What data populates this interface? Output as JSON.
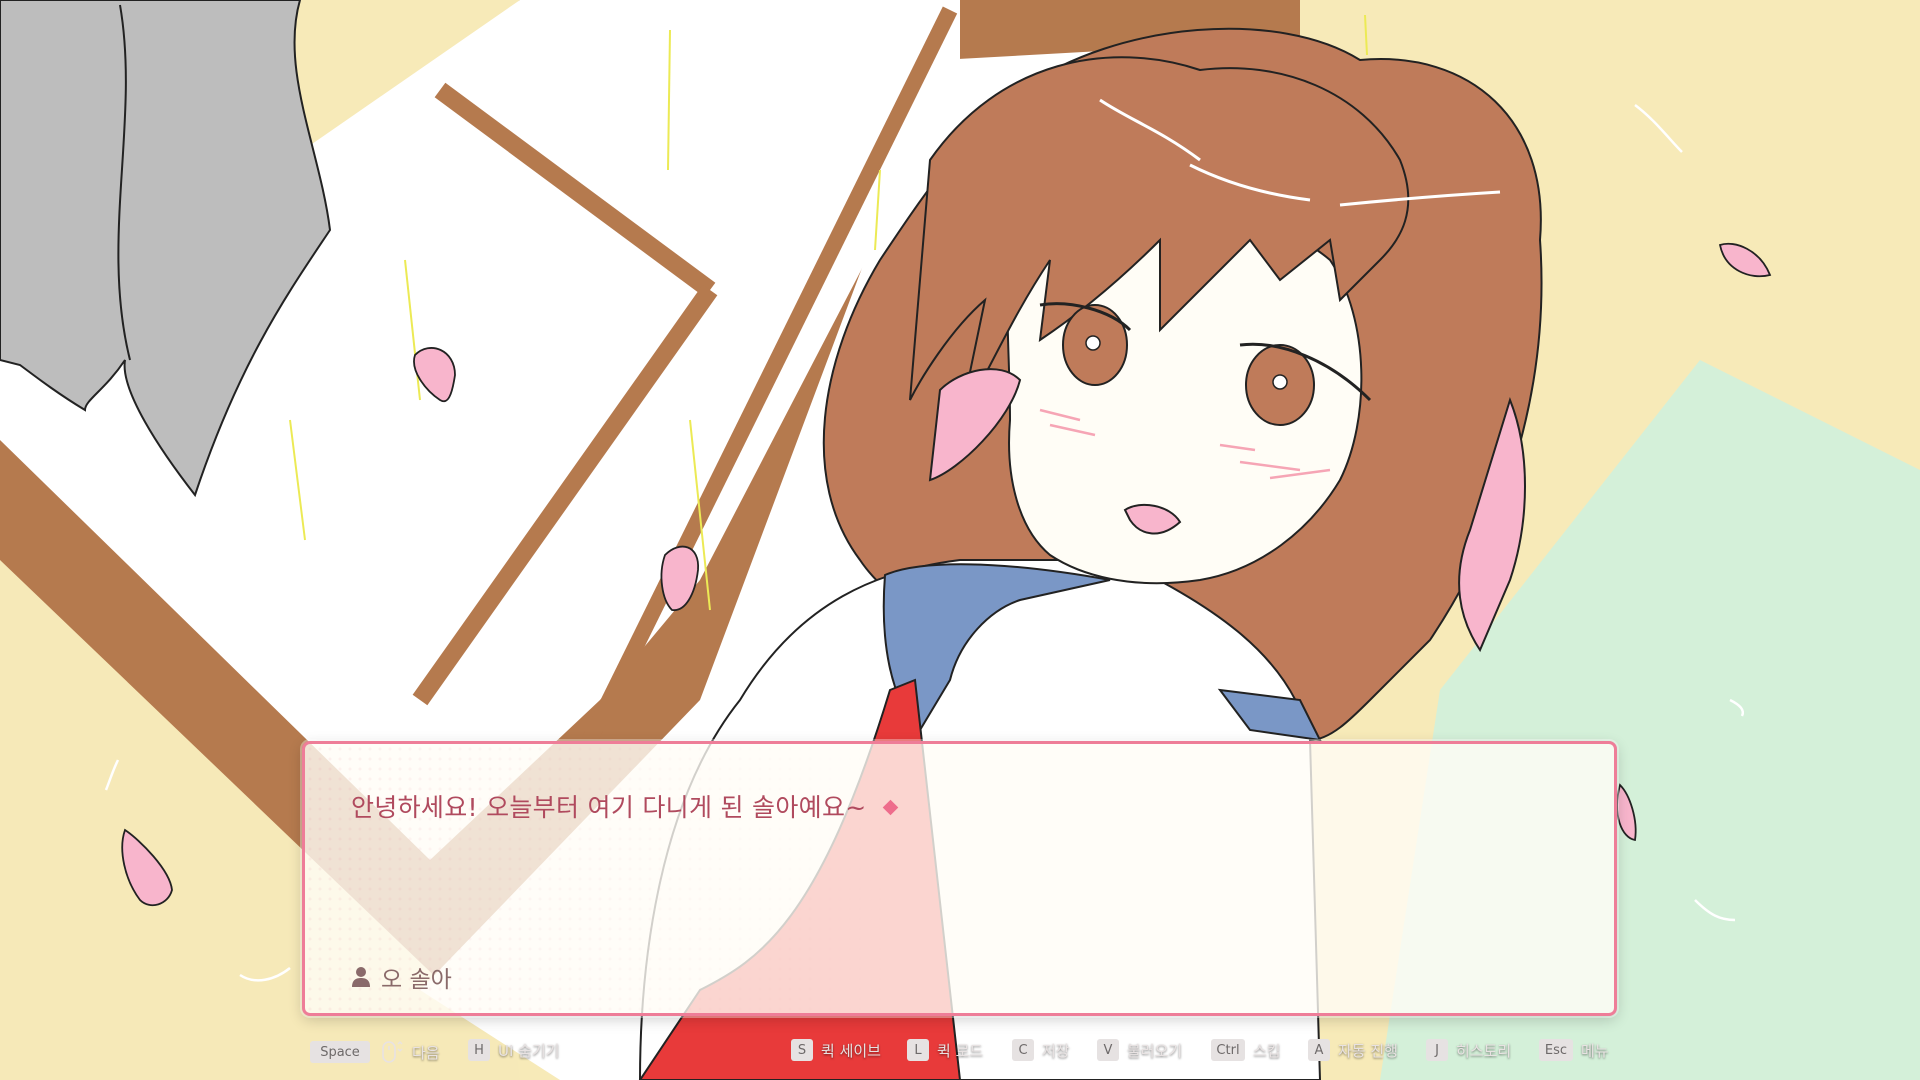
{
  "dialogue": {
    "text": "안녕하세요! 오늘부터 여기 다니게 된 솔아예요~",
    "speaker": "오 솔아",
    "icons": {
      "speaker": "person-icon",
      "advance": "diamond-icon"
    }
  },
  "hints": [
    {
      "key": "Space",
      "label": "다음",
      "extra_icon": "mouse-icon"
    },
    {
      "key": "H",
      "label": "UI 숨기기"
    },
    {
      "key": "S",
      "label": "퀵 세이브"
    },
    {
      "key": "L",
      "label": "퀵 로드"
    },
    {
      "key": "C",
      "label": "저장"
    },
    {
      "key": "V",
      "label": "불러오기"
    },
    {
      "key": "Ctrl",
      "label": "스킵"
    },
    {
      "key": "A",
      "label": "자동 진행"
    },
    {
      "key": "J",
      "label": "히스토리"
    },
    {
      "key": "Esc",
      "label": "메뉴"
    }
  ],
  "colors": {
    "dialog_border": "#ee7d98",
    "dialog_text": "#b04a5e",
    "hair": "#bf7b5a",
    "uniform_collar": "#7a97c6",
    "ribbon": "#e83a3a"
  }
}
